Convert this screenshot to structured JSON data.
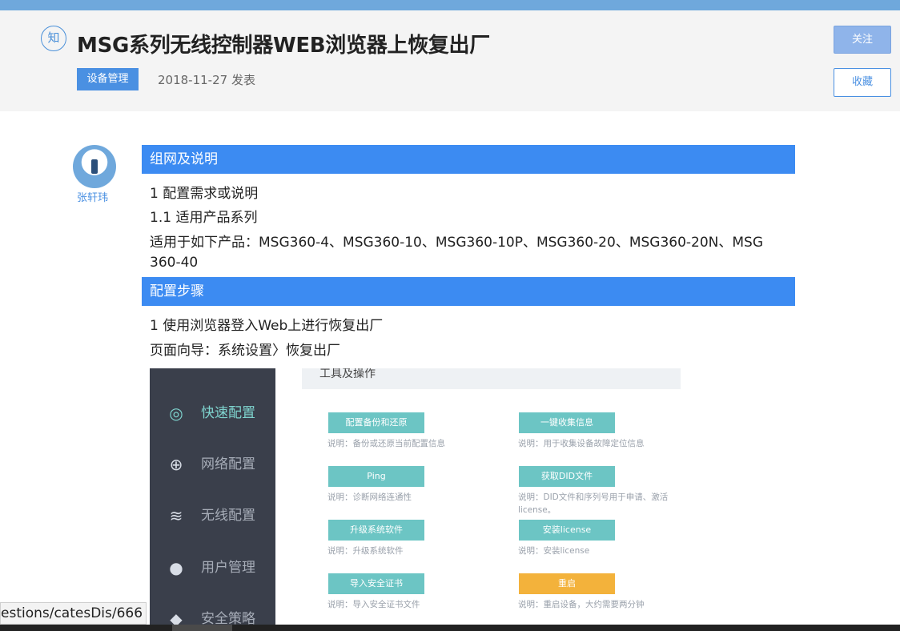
{
  "header": {
    "badge": "知",
    "title": "MSG系列无线控制器WEB浏览器上恢复出厂",
    "tag": "设备管理",
    "date": "2018-11-27 发表",
    "follow_label": "关注",
    "collect_label": "收藏"
  },
  "author": {
    "name": "张轩玮"
  },
  "article": {
    "section1_title": "组网及说明",
    "s1_line1": "1 配置需求或说明",
    "s1_line2": "1.1  适用产品系列",
    "s1_line3": "适用于如下产品：MSG360-4、MSG360-10、MSG360-10P、MSG360-20、MSG360-20N、MSG",
    "s1_line4": "360-40",
    "section2_title": "配置步骤",
    "s2_line1": "1 使用浏览器登入Web上进行恢复出厂",
    "s2_line2": "页面向导：系统设置〉恢复出厂"
  },
  "screenshot": {
    "panel_title": "工具及操作",
    "sidebar": [
      {
        "label": "快速配置",
        "icon": "quick-config-icon",
        "glyph": "◎"
      },
      {
        "label": "网络配置",
        "icon": "globe-icon",
        "glyph": "⊕"
      },
      {
        "label": "无线配置",
        "icon": "wifi-icon",
        "glyph": "≋"
      },
      {
        "label": "用户管理",
        "icon": "user-icon",
        "glyph": "●"
      },
      {
        "label": "安全策略",
        "icon": "shield-icon",
        "glyph": "◆"
      }
    ],
    "tools": [
      {
        "label": "配置备份和还原",
        "desc": "说明：备份或还原当前配置信息"
      },
      {
        "label": "一键收集信息",
        "desc": "说明：用于收集设备故障定位信息"
      },
      {
        "label": "Ping",
        "desc": "说明：诊断网络连通性"
      },
      {
        "label": "获取DID文件",
        "desc": "说明：DID文件和序列号用于申请、激活",
        "desc2": "license。"
      },
      {
        "label": "升级系统软件",
        "desc": "说明：升级系统软件"
      },
      {
        "label": "安装license",
        "desc": "说明：安装license"
      },
      {
        "label": "导入安全证书",
        "desc": "说明：导入安全证书文件"
      },
      {
        "label": "重启",
        "desc": "说明：重启设备，大约需要两分钟"
      }
    ]
  },
  "statusbar": {
    "url": "estions/catesDis/666"
  },
  "colors": {
    "accent": "#3c8bf2",
    "teal": "#6cc5c4",
    "warn": "#f3b23b",
    "sidebar": "#3a3f4b"
  }
}
